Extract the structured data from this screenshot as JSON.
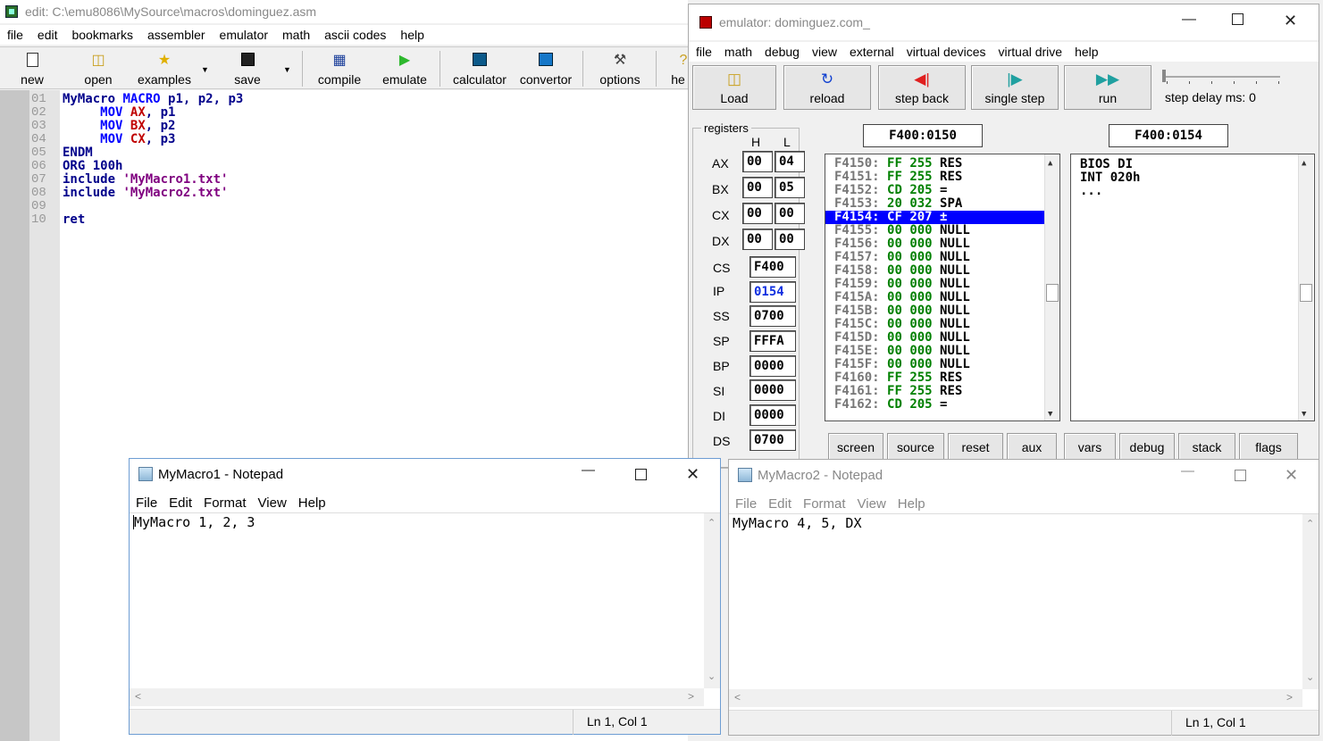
{
  "editor": {
    "title": "edit: C:\\emu8086\\MySource\\macros\\dominguez.asm",
    "menu": [
      "file",
      "edit",
      "bookmarks",
      "assembler",
      "emulator",
      "math",
      "ascii codes",
      "help"
    ],
    "toolbar": {
      "new": "new",
      "open": "open",
      "examples": "examples",
      "save": "save",
      "compile": "compile",
      "emulate": "emulate",
      "calculator": "calculator",
      "convertor": "convertor",
      "options": "options",
      "help": "he"
    },
    "line_numbers": [
      "01",
      "02",
      "03",
      "04",
      "05",
      "06",
      "07",
      "08",
      "09",
      "10"
    ],
    "code": {
      "l1": {
        "a": "MyMacro ",
        "b": "MACRO",
        "c": " p1, p2, p3"
      },
      "l2": {
        "a": "MOV",
        "b": "AX",
        "c": ", p1"
      },
      "l3": {
        "a": "MOV",
        "b": "BX",
        "c": ", p2"
      },
      "l4": {
        "a": "MOV",
        "b": "CX",
        "c": ", p3"
      },
      "l5": "ENDM",
      "l6": "ORG 100h",
      "l7": {
        "a": "include ",
        "b": "'MyMacro1.txt'"
      },
      "l8": {
        "a": "include ",
        "b": "'MyMacro2.txt'"
      },
      "l10": "ret"
    }
  },
  "emulator": {
    "title": "emulator: dominguez.com_",
    "menu": [
      "file",
      "math",
      "debug",
      "view",
      "external",
      "virtual devices",
      "virtual drive",
      "help"
    ],
    "buttons": {
      "load": "Load",
      "reload": "reload",
      "step_back": "step back",
      "single_step": "single step",
      "run": "run"
    },
    "step_delay": "step delay ms: 0",
    "registers_label": "registers",
    "hl": {
      "h": "H",
      "l": "L"
    },
    "regs8": [
      {
        "name": "AX",
        "h": "00",
        "l": "04"
      },
      {
        "name": "BX",
        "h": "00",
        "l": "05"
      },
      {
        "name": "CX",
        "h": "00",
        "l": "00"
      },
      {
        "name": "DX",
        "h": "00",
        "l": "00"
      }
    ],
    "regs16": [
      {
        "name": "CS",
        "value": "F400"
      },
      {
        "name": "IP",
        "value": "0154"
      },
      {
        "name": "SS",
        "value": "0700"
      },
      {
        "name": "SP",
        "value": "FFFA"
      },
      {
        "name": "BP",
        "value": "0000"
      },
      {
        "name": "SI",
        "value": "0000"
      },
      {
        "name": "DI",
        "value": "0000"
      },
      {
        "name": "DS",
        "value": "0700"
      }
    ],
    "mem_addr": "F400:0150",
    "dis_addr": "F400:0154",
    "memory": [
      {
        "addr": "F4150:",
        "hex": "FF",
        "dec": "255",
        "chr": "RES"
      },
      {
        "addr": "F4151:",
        "hex": "FF",
        "dec": "255",
        "chr": "RES"
      },
      {
        "addr": "F4152:",
        "hex": "CD",
        "dec": "205",
        "chr": "="
      },
      {
        "addr": "F4153:",
        "hex": "20",
        "dec": "032",
        "chr": "SPA"
      },
      {
        "addr": "F4154:",
        "hex": "CF",
        "dec": "207",
        "chr": "±"
      },
      {
        "addr": "F4155:",
        "hex": "00",
        "dec": "000",
        "chr": "NULL"
      },
      {
        "addr": "F4156:",
        "hex": "00",
        "dec": "000",
        "chr": "NULL"
      },
      {
        "addr": "F4157:",
        "hex": "00",
        "dec": "000",
        "chr": "NULL"
      },
      {
        "addr": "F4158:",
        "hex": "00",
        "dec": "000",
        "chr": "NULL"
      },
      {
        "addr": "F4159:",
        "hex": "00",
        "dec": "000",
        "chr": "NULL"
      },
      {
        "addr": "F415A:",
        "hex": "00",
        "dec": "000",
        "chr": "NULL"
      },
      {
        "addr": "F415B:",
        "hex": "00",
        "dec": "000",
        "chr": "NULL"
      },
      {
        "addr": "F415C:",
        "hex": "00",
        "dec": "000",
        "chr": "NULL"
      },
      {
        "addr": "F415D:",
        "hex": "00",
        "dec": "000",
        "chr": "NULL"
      },
      {
        "addr": "F415E:",
        "hex": "00",
        "dec": "000",
        "chr": "NULL"
      },
      {
        "addr": "F415F:",
        "hex": "00",
        "dec": "000",
        "chr": "NULL"
      },
      {
        "addr": "F4160:",
        "hex": "FF",
        "dec": "255",
        "chr": "RES"
      },
      {
        "addr": "F4161:",
        "hex": "FF",
        "dec": "255",
        "chr": "RES"
      },
      {
        "addr": "F4162:",
        "hex": "CD",
        "dec": "205",
        "chr": "="
      }
    ],
    "selected_row": 4,
    "disassembly": [
      "BIOS DI",
      "INT 020h",
      "..."
    ],
    "bottom_buttons": [
      "screen",
      "source",
      "reset",
      "aux",
      "vars",
      "debug",
      "stack",
      "flags"
    ]
  },
  "notepad1": {
    "title": "MyMacro1 - Notepad",
    "menu": [
      "File",
      "Edit",
      "Format",
      "View",
      "Help"
    ],
    "text": "MyMacro 1, 2, 3",
    "status": "Ln 1, Col 1"
  },
  "notepad2": {
    "title": "MyMacro2 - Notepad",
    "menu": [
      "File",
      "Edit",
      "Format",
      "View",
      "Help"
    ],
    "text": "MyMacro 4, 5, DX",
    "status": "Ln 1, Col 1"
  }
}
